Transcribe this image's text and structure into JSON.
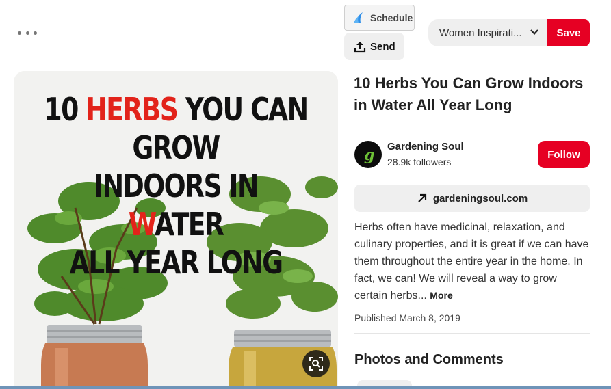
{
  "toolbar": {
    "schedule_label": "Schedule",
    "send_label": "Send",
    "board_selected": "Women Inspirati...",
    "save_label": "Save"
  },
  "pin": {
    "image_headline": {
      "line1_pre": "10 ",
      "line1_red": "HERBS",
      "line1_post": " YOU CAN GROW",
      "line2_pre": "INDOORS IN ",
      "line2_red": "W",
      "line2_post": "ATER",
      "line3": "ALL YEAR LONG"
    },
    "title": "10 Herbs You Can Grow Indoors in Water All Year Long",
    "creator": {
      "name": "Gardening Soul",
      "followers": "28.9k followers",
      "avatar_letter": "g"
    },
    "follow_label": "Follow",
    "link_text": "gardeningsoul.com",
    "description": "Herbs often have medicinal, relaxation, and culinary properties, and it is great if we can have them throughout the entire year in the home. In fact, we can! We will reveal a way to grow certain herbs...",
    "more_label": "More",
    "published": "Published March 8, 2019"
  },
  "comments": {
    "heading": "Photos and Comments"
  },
  "colors": {
    "brand_red": "#e60023",
    "headline_red": "#e2231a"
  },
  "icons": [
    "more-dots-icon",
    "schedule-logo-icon",
    "upload-icon",
    "chevron-down-icon",
    "visual-search-icon",
    "arrow-up-right-icon"
  ]
}
